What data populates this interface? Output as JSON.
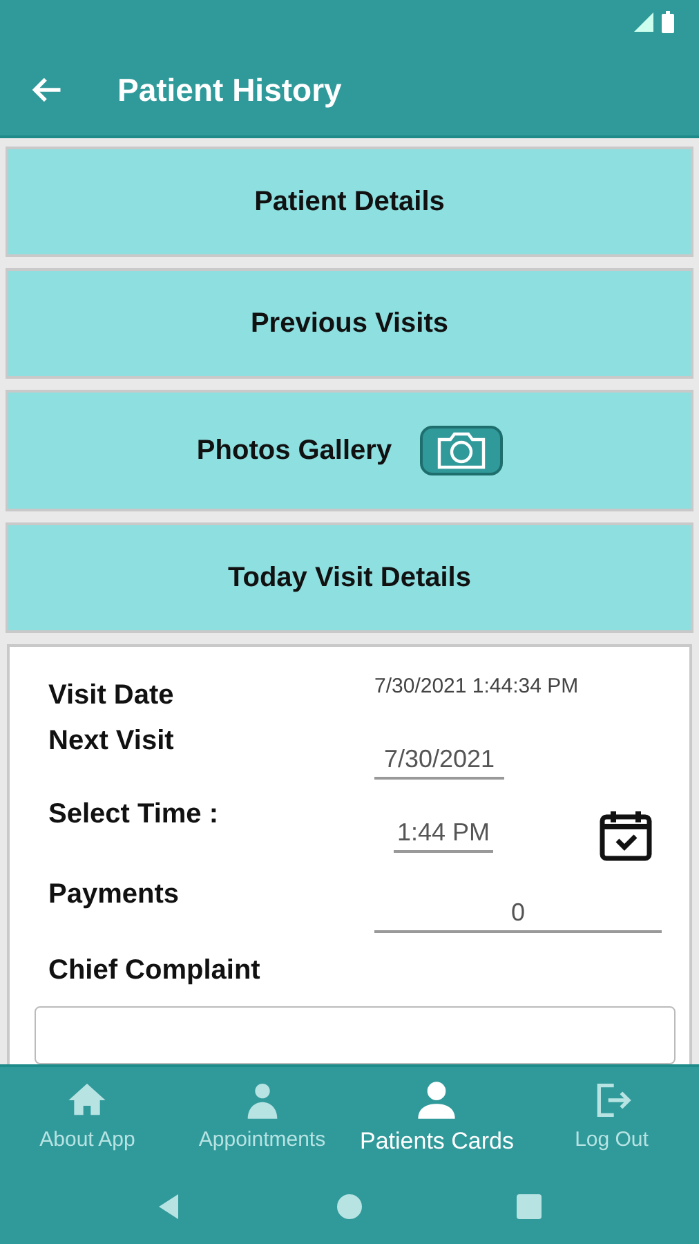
{
  "app_bar": {
    "title": "Patient History"
  },
  "sections": [
    {
      "label": "Patient Details",
      "kind": "plain"
    },
    {
      "label": "Previous Visits",
      "kind": "plain"
    },
    {
      "label": "Photos Gallery",
      "kind": "camera"
    },
    {
      "label": "Today Visit Details",
      "kind": "plain"
    }
  ],
  "form": [
    {
      "label": "Visit Date",
      "kind": "text",
      "value": "7/30/2021 1:44:34 PM"
    },
    {
      "label": "Next Visit",
      "kind": "date",
      "value": "7/30/2021"
    },
    {
      "label": "Select Time :",
      "kind": "time",
      "value": "1:44 PM"
    },
    {
      "label": "Payments",
      "kind": "number",
      "value": "0"
    },
    {
      "label": "Chief Complaint",
      "kind": "textarea"
    }
  ],
  "bottom_nav": [
    {
      "label": "About App",
      "selected": false
    },
    {
      "label": "Appointments",
      "selected": false
    },
    {
      "label": "Patients Cards",
      "selected": true
    },
    {
      "label": "Log Out",
      "selected": false
    }
  ]
}
